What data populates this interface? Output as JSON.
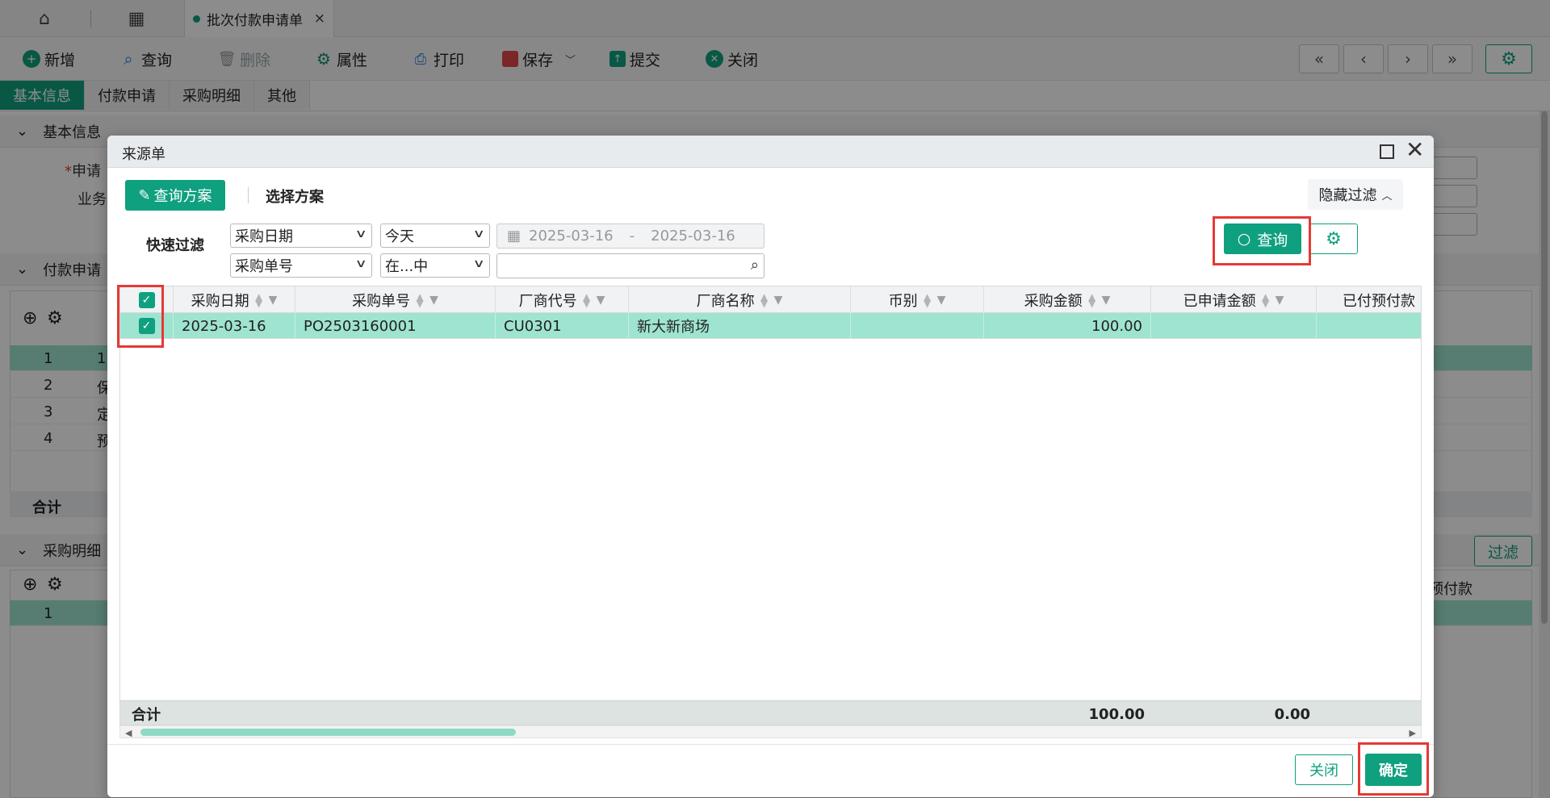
{
  "app": {
    "home_icon": "home-icon",
    "apps_icon": "grid-icon",
    "doc_tab": {
      "label": "批次付款申请单",
      "close": "×"
    }
  },
  "toolbar": {
    "new": "新增",
    "query": "查询",
    "delete": "删除",
    "properties": "属性",
    "print": "打印",
    "save": "保存",
    "submit": "提交",
    "close": "关闭",
    "nav": [
      "«",
      "‹",
      "›",
      "»"
    ]
  },
  "page_tabs": [
    "基本信息",
    "付款申请",
    "采购明细",
    "其他"
  ],
  "background": {
    "section_basic": "基本信息",
    "label_apply": "申请",
    "label_business": "业务",
    "section_payment": "付款申请",
    "payment_rows": [
      "1",
      "2",
      "3",
      "4"
    ],
    "payment_cells": [
      "1",
      "保",
      "定",
      "预"
    ],
    "total_label": "合计",
    "section_purchase": "采购明细",
    "purchase_rows": [
      "1"
    ],
    "filter_button": "过滤",
    "prepaid_header": "预付款"
  },
  "modal": {
    "title": "来源单",
    "scheme_button": "查询方案",
    "scheme_label": "选择方案",
    "hide_filter": "隐藏过滤",
    "quick_filter_label": "快速过滤",
    "filter_field_1": "采购日期",
    "filter_op_1": "今天",
    "date_from": "2025-03-16",
    "date_sep": "-",
    "date_to": "2025-03-16",
    "filter_field_2": "采购单号",
    "filter_op_2": "在...中",
    "filter_value_2": "",
    "query_button": "查询",
    "columns": [
      "采购日期",
      "采购单号",
      "厂商代号",
      "厂商名称",
      "币别",
      "采购金额",
      "已申请金额",
      "已付预付款"
    ],
    "rows": [
      {
        "checked": true,
        "date": "2025-03-16",
        "po_no": "PO2503160001",
        "vendor_code": "CU0301",
        "vendor_name": "新大新商场",
        "currency": "",
        "amount": "100.00",
        "applied": "",
        "prepaid": ""
      }
    ],
    "footer": {
      "label": "合计",
      "amount_total": "100.00",
      "applied_total": "0.00"
    },
    "close_button": "关闭",
    "ok_button": "确定"
  },
  "colors": {
    "accent": "#0fa07f",
    "selected_row": "#9ee4d0",
    "highlight": "#e53935"
  }
}
